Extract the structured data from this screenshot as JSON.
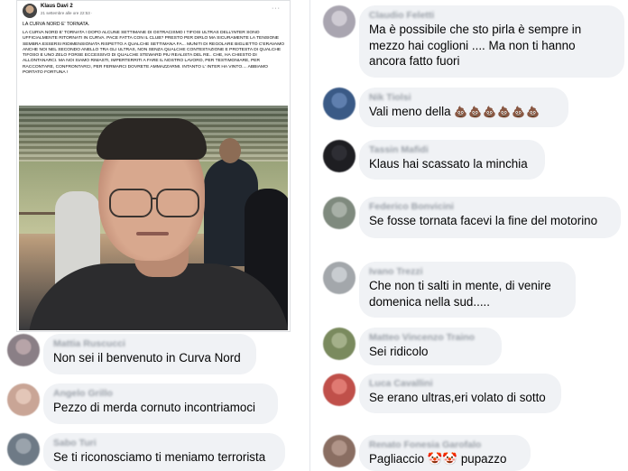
{
  "post": {
    "author": "Klaus Davi 2",
    "meta": "21 settembre alle ore 22:53 · ",
    "more": "···",
    "headline": "LA CURVA NORD E' TORNATA.",
    "body": "LA CURVA NORD E' TORNATA ! DOPO ALCUNE SETTIMANE DI OSTRACISMO I TIFOSI ULTRAS DELL'INTER SONO UFFICIALMENTE RITORNATI IN CURVA. PACE FATTA CON IL CLUB? PRESTO PER DIRLO MA SICURAMENTE LA TENSIONE SEMBRA ESSERSI RIDIMENSIONATA RISPETTO A QUALCHE SETTIMANA FA... MUNITI DI REGOLARE BIGLIETTO C'ERAVAMO ANCHE NOI NEL SECONDO ANELLO TRA GLI ULTRAS, NON SENZA QUALCHE CONTESTAZIONE E PROTESTA DI QUALCHE TIFOSO E UNO ZELO FORSE ECCESSIVO DI QUALCHE STEWARD PIU REALISTA DEL RE.. CHE, HA CHIESTO DI ALLONTANARCI. MA NOI SIAMO RIMASTI, IMPERTERRITI A FARE IL NOSTRO LAVORO, PER TESTIMONIARE, PER RACCONTARE, CONFRONTARCI, PER FERMARCI DOVRETE AMMAZZARMI. INTANTO L' INTER HA VINTO.... ABBIAMO PORTATO FORTUNA !"
  },
  "comments_left": [
    {
      "name": "Mattia Ruscucci",
      "text": "Non sei il benvenuto in Curva Nord",
      "avatar_color": "#8a7f86"
    },
    {
      "name": "Angelo Grillo",
      "text": "Pezzo di merda cornuto incontriamoci",
      "avatar_color": "#c9a596"
    },
    {
      "name": "Sabo Turi",
      "text": "Se ti riconosciamo ti meniamo terrorista",
      "avatar_color": "#6e7a86"
    }
  ],
  "comments_right": [
    {
      "name": "Claudio Feletti",
      "lines": [
        "Ma è possibile che sto pirla è sempre in",
        "mezzo hai coglioni ....  Ma non ti hanno",
        "ancora fatto fuori"
      ],
      "avatar_color": "#a9a5b0"
    },
    {
      "name": "Nik Tiolsi",
      "lines": [
        "Vali meno della"
      ],
      "emoji": "💩💩💩💩💩💩",
      "avatar_color": "#3a5a86"
    },
    {
      "name": "Tassin Mafidi",
      "lines": [
        "Klaus hai scassato la minchia"
      ],
      "avatar_color": "#1e1e22"
    },
    {
      "name": "Federico Bonvicini",
      "lines": [
        "Se fosse tornata facevi la fine del motorino"
      ],
      "avatar_color": "#7f8a7e"
    },
    {
      "name": "Ivano Trezzi",
      "lines": [
        "Che non ti salti in mente, di venire",
        "domenica nella sud....."
      ],
      "avatar_color": "#a3a7ab"
    },
    {
      "name": "Matteo Vincenzo Traino",
      "lines": [
        "Sei ridicolo"
      ],
      "avatar_color": "#7a8a5e"
    },
    {
      "name": "Luca Cavallini",
      "lines": [
        "Se erano ultras,eri volato di sotto"
      ],
      "avatar_color": "#c0504a"
    },
    {
      "name": "Renato Fonesia Garofalo",
      "lines": [
        "Pagliaccio 🤡🤡 pupazzo"
      ],
      "avatar_color": "#8a6e62"
    }
  ],
  "colors": {
    "bubble": "#f0f2f5",
    "text": "#050505",
    "meta": "#65676b"
  }
}
